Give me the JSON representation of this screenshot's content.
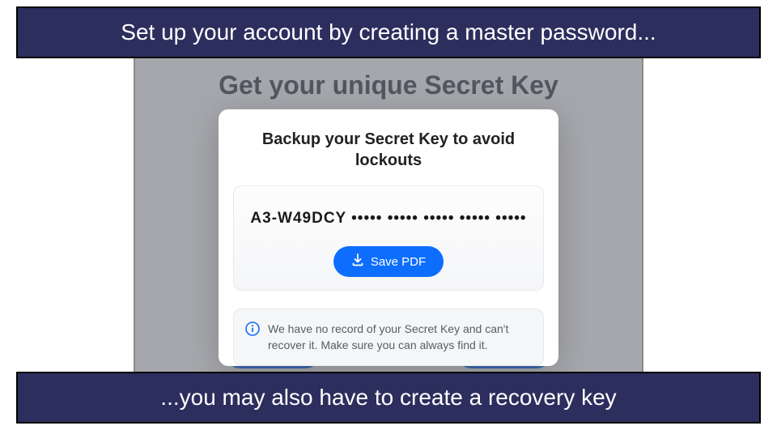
{
  "captions": {
    "top": "Set up your account by creating a master password...",
    "bottom": "...you may also have to create a recovery key"
  },
  "page": {
    "heading": "Get your unique Secret Key"
  },
  "modal": {
    "title": "Backup your Secret Key to avoid lockouts",
    "secret_key": "A3-W49DCY ••••• ••••• ••••• ••••• •••••",
    "save_label": "Save PDF",
    "info_text": "We have no record of your Secret Key and can't recover it. Make sure you can always find it."
  }
}
